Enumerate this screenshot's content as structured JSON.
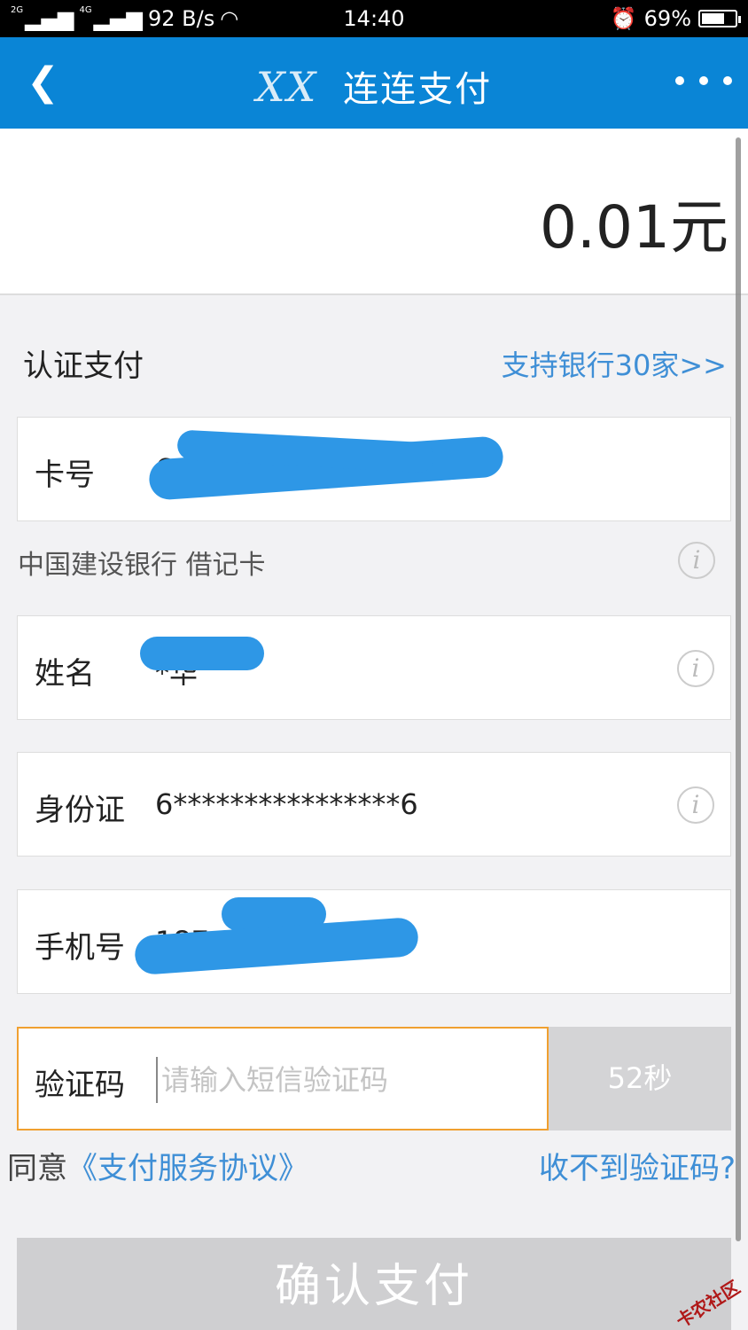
{
  "status_bar": {
    "network_2g": "2G",
    "network_4g": "4G",
    "speed": "92 B/s",
    "time": "14:40",
    "battery": "69%",
    "battery_level": 0.69
  },
  "app_bar": {
    "back_icon": "chevron-left-icon",
    "logo_text": "XX",
    "title": "连连支付",
    "more_icon": "more-dots-icon"
  },
  "payment": {
    "amount": "0.01元"
  },
  "auth": {
    "section_title": "认证支付",
    "bank_support_link": "支持银行30家>>"
  },
  "fields": {
    "card": {
      "label": "卡号",
      "value": "6······578"
    },
    "bank_info": "中国建设银行  借记卡",
    "name": {
      "label": "姓名",
      "value": "*华"
    },
    "id_card": {
      "label": "身份证",
      "value": "6****************6"
    },
    "phone": {
      "label": "手机号",
      "value": "187 1737 112"
    },
    "code": {
      "label": "验证码",
      "placeholder": "请输入短信验证码",
      "countdown": "52秒"
    }
  },
  "agreement": {
    "prefix": "同意",
    "link": "《支付服务协议》",
    "no_code_link": "收不到验证码?"
  },
  "confirm_button": "确认支付",
  "watermark": "卡农社区",
  "colors": {
    "brand_blue": "#0a85d6",
    "link_blue": "#3f8fd6",
    "redaction_blue": "#2e97e6",
    "focus_orange": "#f0a030"
  }
}
